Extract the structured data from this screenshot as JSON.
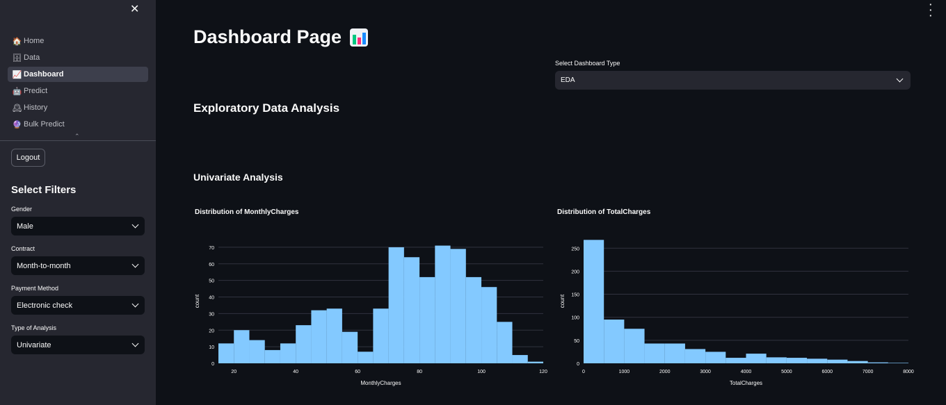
{
  "sidebar": {
    "nav": [
      {
        "label": "Home",
        "icon": "house-icon",
        "emoji": "🏠"
      },
      {
        "label": "Data",
        "icon": "database-icon",
        "emoji": "🗄"
      },
      {
        "label": "Dashboard",
        "icon": "chart-icon",
        "emoji": "📈"
      },
      {
        "label": "Predict",
        "icon": "robot-icon",
        "emoji": "🤖"
      },
      {
        "label": "History",
        "icon": "clock-icon",
        "emoji": "🕰"
      },
      {
        "label": "Bulk Predict",
        "icon": "crystal-ball-icon",
        "emoji": "🔮"
      }
    ],
    "active": "Dashboard",
    "logout_label": "Logout",
    "filters_title": "Select Filters",
    "filters": [
      {
        "label": "Gender",
        "value": "Male"
      },
      {
        "label": "Contract",
        "value": "Month-to-month"
      },
      {
        "label": "Payment Method",
        "value": "Electronic check"
      },
      {
        "label": "Type of Analysis",
        "value": "Univariate"
      }
    ]
  },
  "main": {
    "title": "Dashboard Page",
    "dashboard_type": {
      "label": "Select Dashboard Type",
      "value": "EDA"
    },
    "section_heading": "Exploratory Data Analysis",
    "subsection_heading": "Univariate Analysis"
  },
  "colors": {
    "bar": "#83c9ff",
    "background": "#0e1117",
    "sidebar": "#262730"
  },
  "chart_data": [
    {
      "type": "bar",
      "title": "Distribution of MonthlyCharges",
      "xlabel": "MonthlyCharges",
      "ylabel": "count",
      "xlim": [
        15,
        120
      ],
      "ylim": [
        0,
        75
      ],
      "xticks": [
        20,
        40,
        60,
        80,
        100,
        120
      ],
      "yticks": [
        0,
        10,
        20,
        30,
        40,
        50,
        60,
        70
      ],
      "bin_width": 5,
      "bins_start": [
        15,
        20,
        25,
        30,
        35,
        40,
        45,
        50,
        55,
        60,
        65,
        70,
        75,
        80,
        85,
        90,
        95,
        100,
        105,
        110,
        115
      ],
      "values": [
        12,
        20,
        14,
        8,
        12,
        23,
        32,
        33,
        19,
        7,
        33,
        70,
        64,
        52,
        71,
        69,
        52,
        46,
        25,
        5,
        1
      ]
    },
    {
      "type": "bar",
      "title": "Distribution of TotalCharges",
      "xlabel": "TotalCharges",
      "ylabel": "count",
      "xlim": [
        0,
        8000
      ],
      "ylim": [
        0,
        270
      ],
      "xticks": [
        0,
        1000,
        2000,
        3000,
        4000,
        5000,
        6000,
        7000,
        8000
      ],
      "yticks": [
        0,
        50,
        100,
        150,
        200,
        250
      ],
      "bin_width": 500,
      "bins_start": [
        0,
        500,
        1000,
        1500,
        2000,
        2500,
        3000,
        3500,
        4000,
        4500,
        5000,
        5500,
        6000,
        6500,
        7000,
        7500
      ],
      "values": [
        268,
        95,
        75,
        43,
        43,
        31,
        25,
        12,
        21,
        13,
        12,
        10,
        8,
        5,
        2,
        1
      ]
    }
  ]
}
